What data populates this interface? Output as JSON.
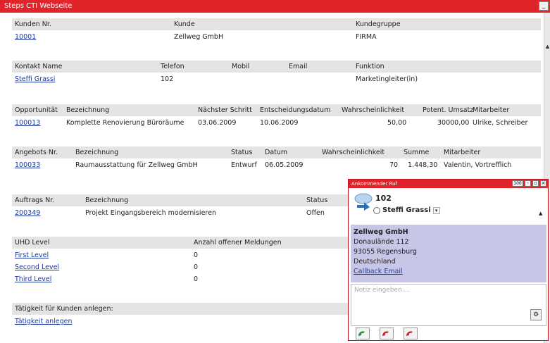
{
  "window": {
    "title": "Steps CTI Webseite",
    "min_label": "_"
  },
  "customer": {
    "headers": [
      "Kunden Nr.",
      "Kunde",
      "Kundegruppe"
    ],
    "row": {
      "nr": "10001",
      "name": "Zellweg GmbH",
      "group": "FIRMA"
    }
  },
  "contact": {
    "headers": [
      "Kontakt Name",
      "Telefon",
      "Mobil",
      "Email",
      "Funktion"
    ],
    "row": {
      "name": "Steffi Grassi",
      "phone": "102",
      "mobile": "",
      "email": "",
      "function": "Marketingleiter(in)"
    }
  },
  "opportunity": {
    "headers": [
      "Opportunität",
      "Bezeichnung",
      "Nächster Schritt",
      "Entscheidungsdatum",
      "Wahrscheinlichkeit",
      "Potent. Umsatz",
      "Mitarbeiter"
    ],
    "row": {
      "nr": "100013",
      "desc": "Komplette Renovierung Büroräume",
      "next": "03.06.2009",
      "decision": "10.06.2009",
      "prob": "50,00",
      "revenue": "30000,00",
      "staff": "Ulrike, Schreiber"
    }
  },
  "offer": {
    "headers": [
      "Angebots Nr.",
      "Bezeichnung",
      "Status",
      "Datum",
      "Wahrscheinlichkeit",
      "Summe",
      "Mitarbeiter"
    ],
    "row": {
      "nr": "100033",
      "desc": "Raumausstattung für Zellweg GmbH",
      "status": "Entwurf",
      "date": "06.05.2009",
      "prob": "70",
      "sum": "1.448,30",
      "staff": "Valentin, Vortrefflich"
    }
  },
  "order": {
    "headers": [
      "Auftrags Nr.",
      "Bezeichnung",
      "Status"
    ],
    "row": {
      "nr": "200349",
      "desc": "Projekt Eingangsbereich modernisieren",
      "status": "Offen"
    }
  },
  "uhd": {
    "headers": [
      "UHD Level",
      "Anzahl offener Meldungen"
    ],
    "rows": [
      {
        "level": "First Level",
        "count": "0"
      },
      {
        "level": "Second Level",
        "count": "0"
      },
      {
        "level": "Third Level",
        "count": "0"
      }
    ]
  },
  "activity": {
    "header": "Tätigkeit für Kunden anlegen:",
    "link": "Tätigkeit anlegen"
  },
  "popup": {
    "title": "Ankommender Ruf",
    "counter": "100",
    "number": "102",
    "caller": "Steffi Grassi",
    "company": "Zellweg GmbH",
    "street": "Donaulände 112",
    "city": "93055 Regensburg",
    "country": "Deutschland",
    "actions": "Callback Email",
    "note_placeholder": "Notiz eingeben...."
  },
  "colors": {
    "titlebar": "#e0242a",
    "link": "#1f3a9e",
    "header_bg": "#e4e4e4",
    "info_bg": "#c8c6e6",
    "call_green": "#1a8a3a",
    "call_red": "#c8202a"
  }
}
